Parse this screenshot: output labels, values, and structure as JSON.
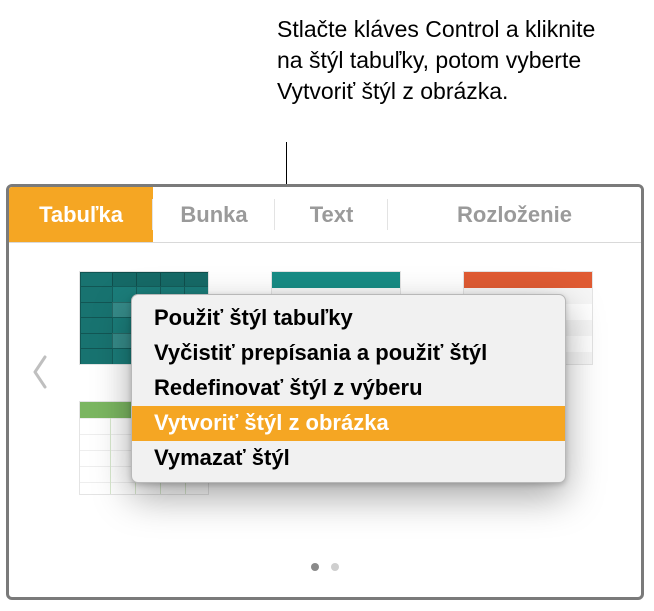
{
  "callout": {
    "text": "Stlačte kláves Control a kliknite na štýl tabuľky, potom vyberte Vytvoriť štýl z obrázka."
  },
  "tabs": {
    "items": [
      {
        "label": "Tabuľka",
        "active": true
      },
      {
        "label": "Bunka",
        "active": false
      },
      {
        "label": "Text",
        "active": false
      },
      {
        "label": "Rozloženie",
        "active": false
      }
    ]
  },
  "styles": {
    "thumbs": [
      {
        "name": "teal-solid"
      },
      {
        "name": "teal-header"
      },
      {
        "name": "orange-header"
      },
      {
        "name": "green-header"
      }
    ],
    "pager": {
      "count": 2,
      "active": 0
    }
  },
  "context_menu": {
    "items": [
      {
        "label": "Použiť štýl tabuľky",
        "highlight": false
      },
      {
        "label": "Vyčistiť prepísania a použiť štýl",
        "highlight": false
      },
      {
        "label": "Redefinovať štýl z výberu",
        "highlight": false
      },
      {
        "label": "Vytvoriť štýl z obrázka",
        "highlight": true
      },
      {
        "label": "Vymazať štýl",
        "highlight": false
      }
    ]
  }
}
